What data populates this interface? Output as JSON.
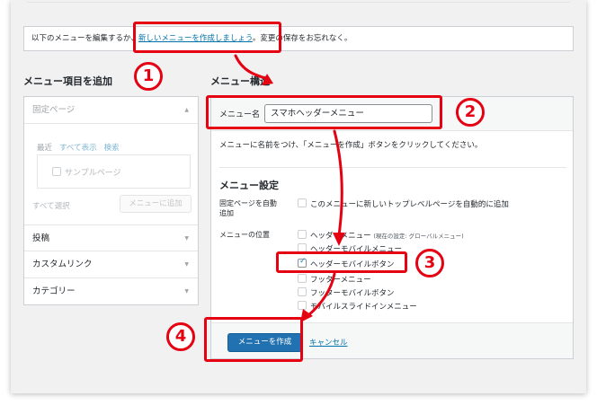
{
  "notice": {
    "prefix": "以下のメニューを編集するか、",
    "link": "新しいメニューを作成しましょう",
    "suffix": "。変更の保存をお忘れなく。"
  },
  "left": {
    "title": "メニュー項目を追加",
    "pages": {
      "label": "固定ページ",
      "tabs": [
        "最近",
        "すべて表示",
        "検索"
      ],
      "sample": "サンプルページ",
      "select_all": "すべて選択",
      "add_button": "メニューに追加"
    },
    "accordions": [
      "投稿",
      "カスタムリンク",
      "カテゴリー"
    ]
  },
  "right": {
    "title": "メニュー構造",
    "name_label": "メニュー名",
    "name_value": "スマホヘッダーメニュー",
    "help": "メニューに名前をつけ、「メニューを作成」ボタンをクリックしてください。",
    "settings_title": "メニュー設定",
    "auto_label_1": "固定ページを自動",
    "auto_label_2": "追加",
    "auto_option": "このメニューに新しいトップレベルページを自動的に追加",
    "locations_label": "メニューの位置",
    "locations": [
      {
        "label": "ヘッダーメニュー",
        "note": "(現在の設定: グローバルメニュー)",
        "checked": false
      },
      {
        "label": "ヘッダーモバイルメニュー",
        "note": "",
        "checked": false
      },
      {
        "label": "ヘッダーモバイルボタン",
        "note": "",
        "checked": true
      },
      {
        "label": "フッターメニュー",
        "note": "",
        "checked": false
      },
      {
        "label": "フッターモバイルボタン",
        "note": "",
        "checked": false
      },
      {
        "label": "モバイルスライドインメニュー",
        "note": "",
        "checked": false
      }
    ],
    "create_button": "メニューを作成",
    "cancel": "キャンセル"
  },
  "annotations": {
    "step1": "1",
    "step2": "2",
    "step3": "3",
    "step4": "4",
    "color": "#e50012"
  }
}
